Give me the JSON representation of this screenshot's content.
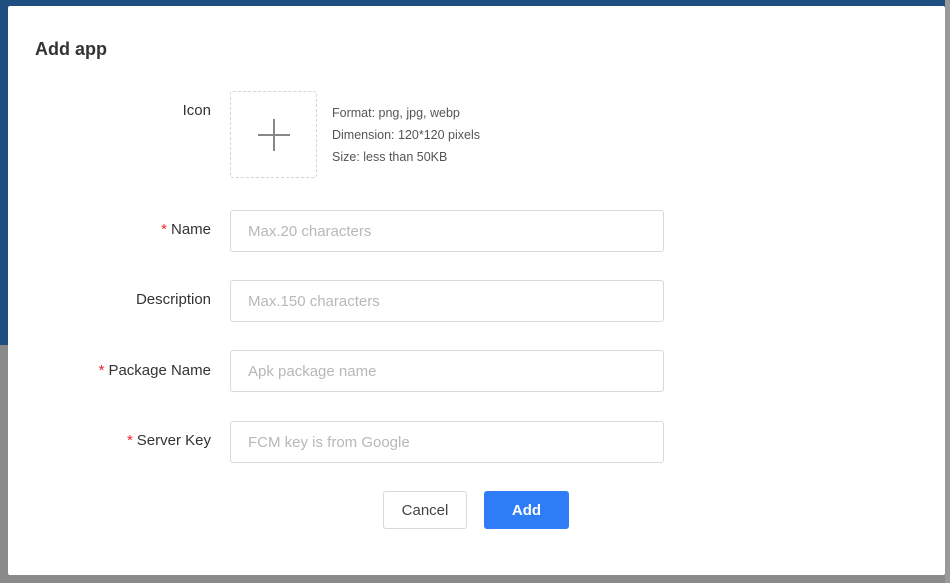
{
  "modal": {
    "title": "Add app",
    "icon_section": {
      "label": "Icon",
      "hints": [
        "Format: png, jpg, webp",
        "Dimension: 120*120 pixels",
        "Size: less than 50KB"
      ]
    },
    "fields": {
      "name": {
        "label": "Name",
        "required_mark": "*",
        "placeholder": "Max.20 characters",
        "value": ""
      },
      "description": {
        "label": "Description",
        "placeholder": "Max.150 characters",
        "value": ""
      },
      "package_name": {
        "label": "Package Name",
        "required_mark": "*",
        "placeholder": "Apk package name",
        "value": ""
      },
      "server_key": {
        "label": "Server Key",
        "required_mark": "*",
        "placeholder": "FCM key is from Google",
        "value": ""
      }
    },
    "buttons": {
      "cancel_label": "Cancel",
      "add_label": "Add"
    }
  },
  "colors": {
    "primary": "#2f7df6",
    "required": "#f5222d",
    "placeholder": "#b8b8b8"
  },
  "icons": {
    "upload": "plus-icon"
  }
}
